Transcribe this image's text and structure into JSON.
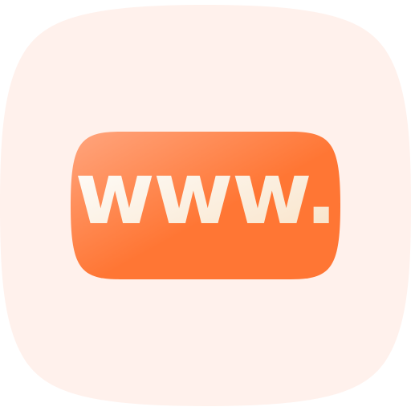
{
  "icon": {
    "name": "www-icon",
    "label": "www.",
    "colors": {
      "background_squircle": "#FFF1EC",
      "badge_light": "#FFA57E",
      "badge_dark": "#FF7634",
      "text_light": "#FFFFFF",
      "text_dark": "#F8E2C6"
    }
  }
}
